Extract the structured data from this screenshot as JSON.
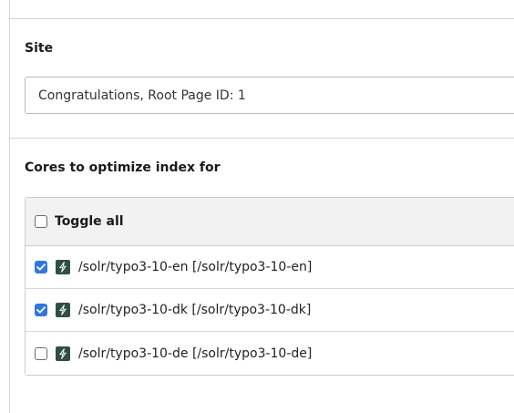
{
  "site": {
    "heading": "Site",
    "selected": "Congratulations, Root Page ID: 1"
  },
  "cores": {
    "heading": "Cores to optimize index for",
    "toggle_all_label": "Toggle all",
    "toggle_all_checked": false,
    "items": [
      {
        "label": "/solr/typo3-10-en [/solr/typo3-10-en]",
        "checked": true,
        "icon": "solr-core-icon"
      },
      {
        "label": "/solr/typo3-10-dk [/solr/typo3-10-dk]",
        "checked": true,
        "icon": "solr-core-icon"
      },
      {
        "label": "/solr/typo3-10-de [/solr/typo3-10-de]",
        "checked": false,
        "icon": "solr-core-icon"
      }
    ]
  },
  "colors": {
    "checkbox_checked": "#2f77e0",
    "core_icon_bg": "#2f4f46",
    "header_row_bg": "#f2f2f2"
  }
}
